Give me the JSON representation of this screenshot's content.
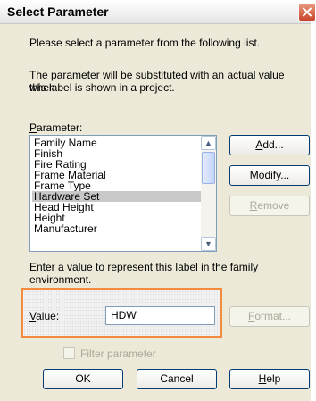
{
  "window": {
    "title": "Select Parameter"
  },
  "intro": {
    "line1": "Please select a parameter from the following list.",
    "line2a": "The parameter will be substituted with an actual value when",
    "line2b": "this label is shown in a project."
  },
  "parameter": {
    "label_key": "P",
    "label_rest": "arameter:",
    "items": [
      "Family Name",
      "Finish",
      "Fire Rating",
      "Frame Material",
      "Frame Type",
      "Hardware Set",
      "Head Height",
      "Height",
      "Manufacturer"
    ],
    "selected": "Hardware Set"
  },
  "buttons": {
    "add_key": "A",
    "add_rest": "dd...",
    "modify_key": "M",
    "modify_rest": "odify...",
    "remove_key": "R",
    "remove_rest": "emove",
    "format_key": "F",
    "format_rest": "ormat...",
    "ok": "OK",
    "cancel": "Cancel",
    "help_key": "H",
    "help_rest": "elp"
  },
  "value_section": {
    "hint": "Enter a value to represent this label in the family environment.",
    "label_key": "V",
    "label_rest": "alue:",
    "value": "HDW",
    "filter_label": "Filter parameter"
  }
}
